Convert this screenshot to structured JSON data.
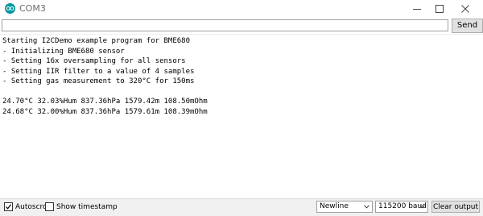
{
  "window": {
    "title": "COM3"
  },
  "sendbar": {
    "input_value": "",
    "send_label": "Send"
  },
  "console": {
    "lines": [
      "Starting I2CDemo example program for BME680",
      "- Initializing BME680 sensor",
      "- Setting 16x oversampling for all sensors",
      "- Setting IIR filter to a value of 4 samples",
      "- Setting gas measurement to 320°C for 150ms",
      "",
      "24.70°C 32.03%Hum 837.36hPa 1579.42m 108.50mOhm",
      "24.68°C 32.00%Hum 837.36hPa 1579.61m 108.39mOhm"
    ]
  },
  "bottombar": {
    "autoscroll_label": "Autoscroll",
    "autoscroll_checked": true,
    "timestamp_label": "Show timestamp",
    "timestamp_checked": false,
    "line_ending": "Newline",
    "baud": "115200 baud",
    "clear_label": "Clear output"
  },
  "colors": {
    "accent": "#00979c"
  },
  "icons": {
    "app": "arduino-logo-icon",
    "minimize": "minimize-icon",
    "maximize": "maximize-icon",
    "close": "close-icon",
    "checkmark": "checkmark-icon",
    "dropdown": "chevron-down-icon"
  }
}
